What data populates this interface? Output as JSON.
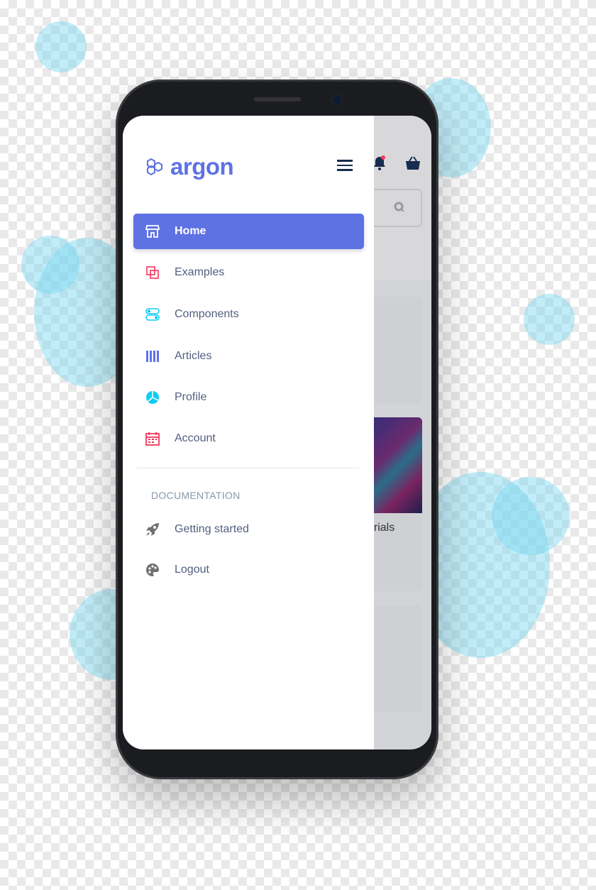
{
  "app": {
    "brand": "argon",
    "accent": "#5e72e4"
  },
  "drawer": {
    "items": [
      {
        "label": "Home",
        "icon": "shop-icon",
        "color": "#ffffff",
        "active": true
      },
      {
        "label": "Examples",
        "icon": "copy-icon",
        "color": "#f5365c"
      },
      {
        "label": "Components",
        "icon": "toggles-icon",
        "color": "#11cdef"
      },
      {
        "label": "Articles",
        "icon": "spaceship-bars-icon",
        "color": "#5e72e4"
      },
      {
        "label": "Profile",
        "icon": "pie-chart-icon",
        "color": "#11cdef"
      },
      {
        "label": "Account",
        "icon": "calendar-icon",
        "color": "#f5365c"
      }
    ],
    "section_title": "DOCUMENTATION",
    "doc_items": [
      {
        "label": "Getting started",
        "icon": "rocket-icon"
      },
      {
        "label": "Logout",
        "icon": "palette-icon"
      }
    ]
  },
  "background_app": {
    "card_text": "erials",
    "notification_color": "#f5365c"
  }
}
